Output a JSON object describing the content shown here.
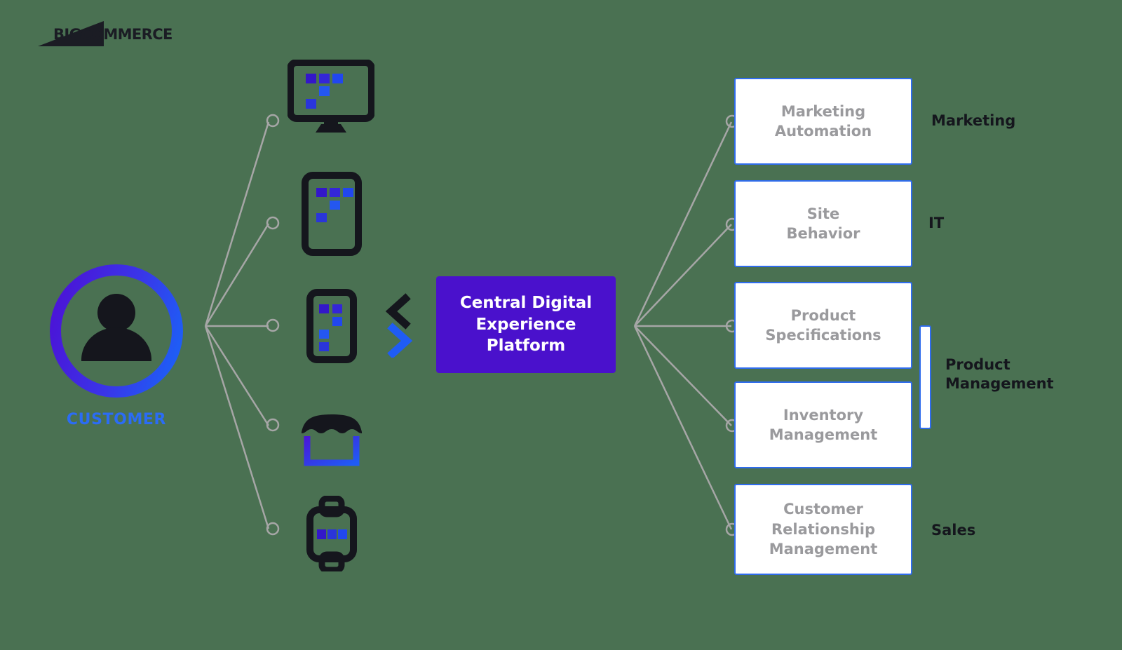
{
  "background_color": "#4a7152",
  "brand": {
    "logo_text": "BIGCOMMERCE",
    "logo_icon": "bigcommerce-triangle-logo"
  },
  "colors": {
    "purple": "#4a11cc",
    "blue": "#2f6ced",
    "customer_label_blue": "#2b6cf5",
    "box_text_gray": "#9a9a9d",
    "line_gray": "#a6a6a6",
    "dark": "#15161d"
  },
  "customer": {
    "label": "CUSTOMER",
    "icon": "person-avatar-icon"
  },
  "devices": [
    {
      "name": "desktop-monitor-icon",
      "squares": 5
    },
    {
      "name": "tablet-icon",
      "squares": 5
    },
    {
      "name": "smartphone-icon",
      "squares": 5
    },
    {
      "name": "storefront-icon",
      "squares": 0
    },
    {
      "name": "smartwatch-icon",
      "squares": 3
    }
  ],
  "chevrons": {
    "left_chevron_icon": "chevron-left-icon",
    "right_chevron_icon": "chevron-right-icon"
  },
  "platform": {
    "title": "Central Digital\nExperience\nPlatform"
  },
  "systems": [
    {
      "label": "Marketing\nAutomation",
      "group": "Marketing"
    },
    {
      "label": "Site\nBehavior",
      "group": "IT"
    },
    {
      "label": "Product\nSpecifications",
      "group": "Product Management"
    },
    {
      "label": "Inventory\nManagement",
      "group": "Product Management"
    },
    {
      "label": "Customer\nRelationship\nManagement",
      "group": "Sales"
    }
  ],
  "group_labels": [
    {
      "text": "Marketing"
    },
    {
      "text": "IT"
    },
    {
      "text": "Product\nManagement"
    },
    {
      "text": "Sales"
    }
  ]
}
